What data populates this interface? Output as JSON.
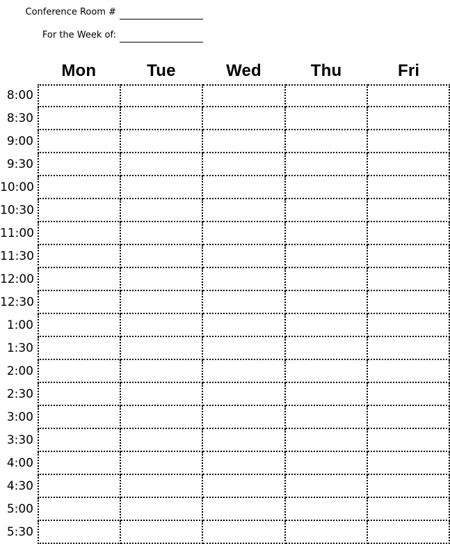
{
  "form": {
    "fields": [
      {
        "label": "Conference Room #",
        "value": ""
      },
      {
        "label": "For the Week of:",
        "value": ""
      }
    ]
  },
  "schedule": {
    "days": [
      "Mon",
      "Tue",
      "Wed",
      "Thu",
      "Fri"
    ],
    "times": [
      "8:00",
      "8:30",
      "9:00",
      "9:30",
      "10:00",
      "10:30",
      "11:00",
      "11:30",
      "12:00",
      "12:30",
      "1:00",
      "1:30",
      "2:00",
      "2:30",
      "3:00",
      "3:30",
      "4:00",
      "4:30",
      "5:00",
      "5:30"
    ],
    "cells": []
  },
  "colors": {
    "ink": "#000000",
    "paper": "#ffffff",
    "gridline": "#000000"
  }
}
